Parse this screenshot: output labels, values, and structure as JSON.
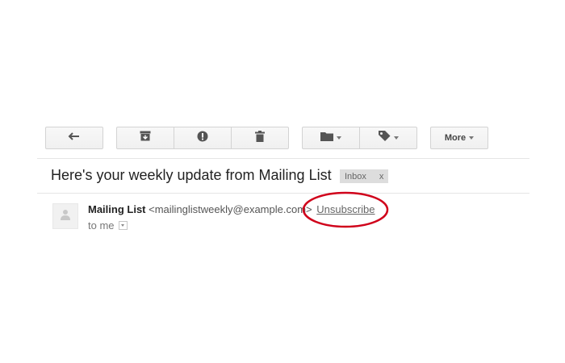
{
  "toolbar": {
    "back_icon": "reply-arrow-icon",
    "archive_icon": "archive-icon",
    "spam_icon": "report-spam-icon",
    "delete_icon": "trash-icon",
    "move_icon": "folder-icon",
    "labels_icon": "label-tag-icon",
    "more_label": "More"
  },
  "email": {
    "subject": "Here's your weekly update from Mailing List",
    "label": "Inbox",
    "label_remove": "x",
    "sender_name": "Mailing List",
    "sender_email": "<mailinglistweekly@example.com>",
    "unsubscribe": "Unsubscribe",
    "recipient": "to me"
  },
  "colors": {
    "annotation": "#d0021b"
  }
}
